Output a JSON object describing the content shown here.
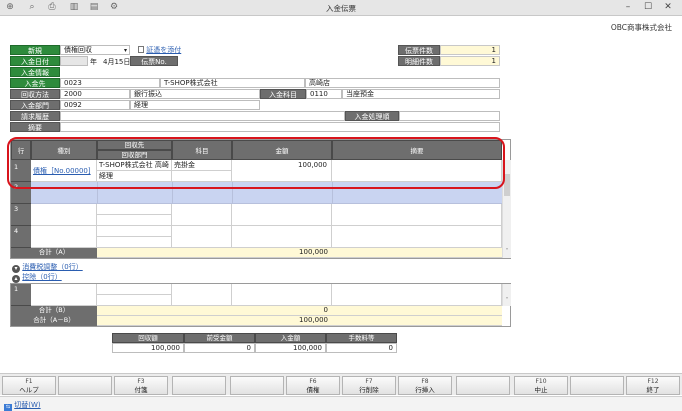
{
  "window": {
    "title": "入金伝票",
    "company": "OBC商事株式会社"
  },
  "toolbar": {
    "icons": [
      "search-plus-icon",
      "print-preview-icon",
      "print-icon",
      "delete-icon",
      "display-icon",
      "settings-icon"
    ]
  },
  "header": {
    "mode_label": "新規",
    "type_value": "債権回収",
    "attach_link": "証憑を添付",
    "date_label": "入金日付",
    "date_year_suffix": "年",
    "date_value": "4月15日",
    "slip_no_label": "伝票No.",
    "info_label": "入金情報",
    "payer_label": "入金先",
    "payer_code": "0023",
    "payer_name": "T-SHOP株式会社",
    "payer_branch": "高崎店",
    "method_label": "回収方法",
    "method_code": "2000",
    "method_name": "銀行振込",
    "account_label": "入金科目",
    "account_code": "0110",
    "account_name": "当座預金",
    "dept_label": "入金部門",
    "dept_code": "0092",
    "dept_name": "経理",
    "history_label": "請求履歴",
    "process_label": "入金処理順",
    "memo_label": "摘要"
  },
  "counts": {
    "slip_count_label": "伝票件数",
    "slip_count": "1",
    "detail_count_label": "明細件数",
    "detail_count": "1"
  },
  "grid": {
    "headers": {
      "row": "行",
      "type": "種別",
      "dest": "回収先",
      "dest_dept": "回収部門",
      "subject": "科目",
      "amount": "金額",
      "memo": "摘要"
    },
    "rows": [
      {
        "num": "1",
        "type": "債権［No.00000]",
        "dest": "T-SHOP株式会社 高崎",
        "dept": "経理",
        "subject": "売掛金",
        "amount": "100,000"
      },
      {
        "num": "2"
      },
      {
        "num": "3"
      },
      {
        "num": "4"
      }
    ],
    "total_a_label": "合計（A）",
    "total_a": "100,000"
  },
  "sections": {
    "tax_adjust": "消費税調整（0行）",
    "deduction": "控除（0行）"
  },
  "deduction_grid": {
    "rows": [
      {
        "num": "1"
      }
    ],
    "total_b_label": "合計（B）",
    "total_b": "0",
    "total_ab_label": "合計（A－B）",
    "total_ab": "100,000"
  },
  "summary": {
    "headers": [
      "回収額",
      "前受金額",
      "入金額",
      "手数料等"
    ],
    "values": [
      "100,000",
      "0",
      "100,000",
      "0"
    ]
  },
  "fkeys": [
    {
      "fn": "F1",
      "label": "ヘルプ"
    },
    {
      "fn": "",
      "label": ""
    },
    {
      "fn": "F3",
      "label": "付箋"
    },
    {
      "fn": "",
      "label": ""
    },
    {
      "fn": "",
      "label": ""
    },
    {
      "fn": "F6",
      "label": "債権"
    },
    {
      "fn": "F7",
      "label": "行削除"
    },
    {
      "fn": "F8",
      "label": "行挿入"
    },
    {
      "fn": "",
      "label": ""
    },
    {
      "fn": "F10",
      "label": "中止"
    },
    {
      "fn": "",
      "label": ""
    },
    {
      "fn": "F12",
      "label": "終了"
    }
  ],
  "status": {
    "switch_label": "切替(W)"
  }
}
